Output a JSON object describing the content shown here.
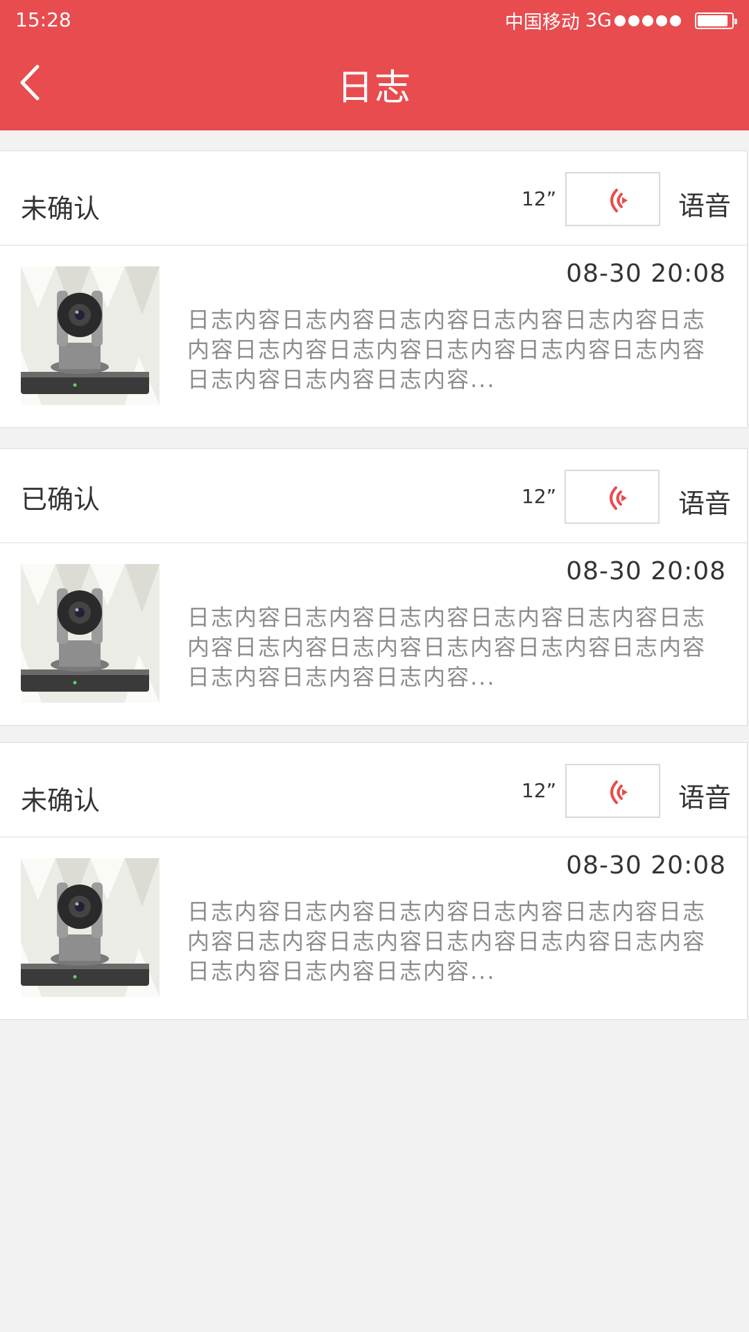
{
  "statusbar": {
    "time": "15:28",
    "carrier": "中国移动",
    "network": "3G",
    "signal_level": 5,
    "battery_percent": 90
  },
  "header": {
    "back_icon": "chevron-left-icon",
    "title": "日志",
    "background_color": "#e84c4f"
  },
  "logs": [
    {
      "status": "未确认",
      "duration": "12”",
      "voice_label": "语音",
      "voice_icon": "sound-wave-icon",
      "timestamp": "08-30 20:08",
      "content": "日志内容日志内容日志内容日志内容日志内容日志内容日志内容日志内容日志内容日志内容日志内容日志内容日志内容日志内容...",
      "thumbnail": "camera-thumbnail"
    },
    {
      "status": "已确认",
      "duration": "12”",
      "voice_label": "语音",
      "voice_icon": "sound-wave-icon",
      "timestamp": "08-30 20:08",
      "content": "日志内容日志内容日志内容日志内容日志内容日志内容日志内容日志内容日志内容日志内容日志内容日志内容日志内容日志内容...",
      "thumbnail": "camera-thumbnail"
    },
    {
      "status": "未确认",
      "duration": "12”",
      "voice_label": "语音",
      "voice_icon": "sound-wave-icon",
      "timestamp": "08-30 20:08",
      "content": "日志内容日志内容日志内容日志内容日志内容日志内容日志内容日志内容日志内容日志内容日志内容日志内容日志内容日志内容...",
      "thumbnail": "camera-thumbnail"
    }
  ]
}
